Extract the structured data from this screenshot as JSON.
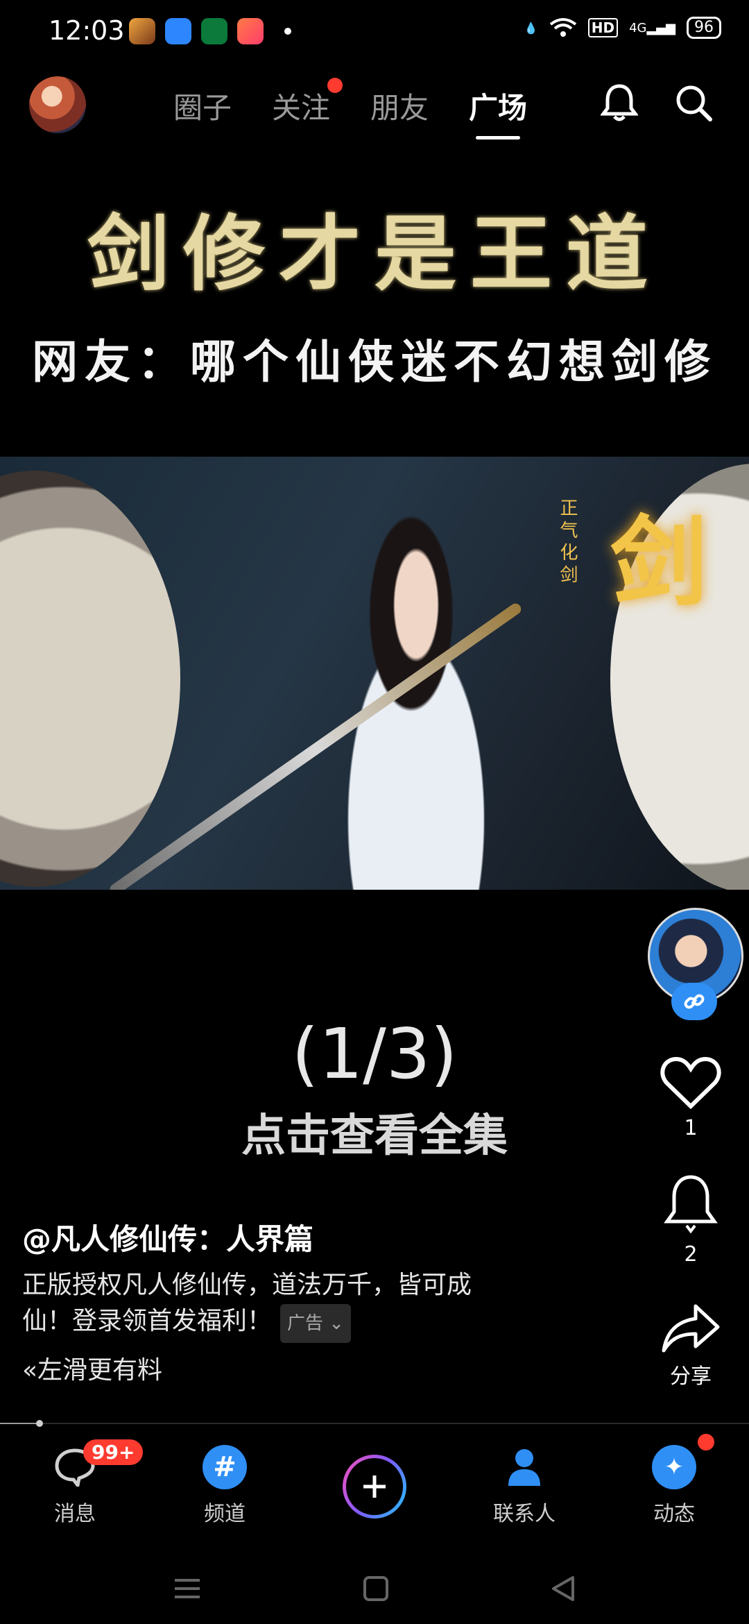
{
  "status_bar": {
    "time": "12:03",
    "battery": "96",
    "network": "4G",
    "hd": "HD"
  },
  "nav": {
    "tabs": [
      {
        "label": "圈子"
      },
      {
        "label": "关注"
      },
      {
        "label": "朋友"
      },
      {
        "label": "广场"
      }
    ]
  },
  "video": {
    "title_line1": "剑修才是王道",
    "title_line2": "网友：哪个仙侠迷不幻想剑修",
    "frame_glyph": "剑",
    "frame_vertical_text": "正气化剑",
    "episode_counter": "(1/3)",
    "watch_all": "点击查看全集",
    "progress": 0.05
  },
  "actions": {
    "likes": "1",
    "comments": "2",
    "share_label": "分享"
  },
  "caption": {
    "handle": "@凡人修仙传：人界篇",
    "description": "正版授权凡人修仙传，道法万千，皆可成仙！登录领首发福利！",
    "ad_label": "广告",
    "swipe_hint": "左滑更有料"
  },
  "bottom_nav": {
    "items": [
      {
        "label": "消息",
        "badge": "99+"
      },
      {
        "label": "频道"
      },
      {
        "label": ""
      },
      {
        "label": "联系人"
      },
      {
        "label": "动态"
      }
    ]
  },
  "colors": {
    "accent": "#2f8ff5",
    "badge": "#ff3b30",
    "title_gold": "#e6d8a2"
  }
}
